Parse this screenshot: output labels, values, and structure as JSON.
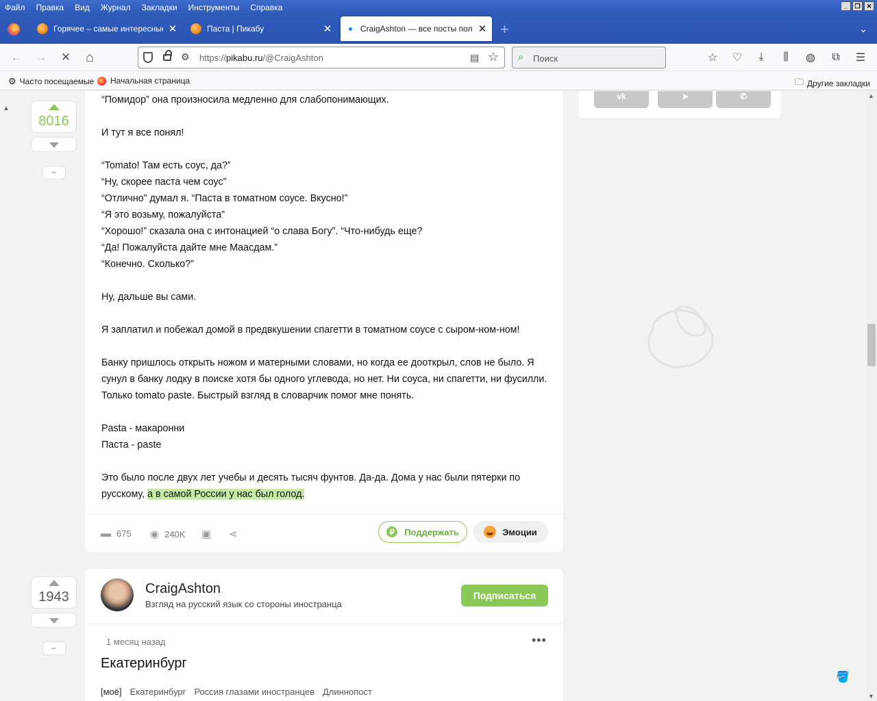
{
  "menu": [
    "Файл",
    "Правка",
    "Вид",
    "Журнал",
    "Закладки",
    "Инструменты",
    "Справка"
  ],
  "window_controls": {
    "minimize": "_",
    "restore": "❐",
    "close": "✕"
  },
  "tabs": [
    {
      "label": "Горячее – самые интересные и о",
      "close": "✕"
    },
    {
      "label": "Паста | Пикабу",
      "close": "✕"
    },
    {
      "label": "CraigAshton — все посты пользов",
      "close": "✕"
    }
  ],
  "new_tab": "+",
  "tab_list": "⌄",
  "nav": {
    "back": "←",
    "forward": "→",
    "stop": "✕",
    "home": "⌂",
    "url_prefix": "https://",
    "url_domain": "pikabu.ru",
    "url_path": "/@CraigAshton",
    "search_placeholder": "Поиск"
  },
  "toolbar_icons": [
    "pocket-save-icon",
    "pocket-icon",
    "download-icon",
    "library-icon",
    "translate-icon",
    "extensions-icon",
    "menu-icon"
  ],
  "bookmarks": {
    "frequent": "Часто посещаемые",
    "start": "Начальная страница",
    "other": "Другие закладки"
  },
  "post1": {
    "rating": "8016",
    "minus": "–",
    "paragraphs": [
      [
        "“Помидор” она произносила медленно для слабопонимающих."
      ],
      [
        "И тут я все понял!"
      ],
      [
        "“Tomato! Там есть соус, да?”",
        "“Ну, скорее паста чем соус”",
        "“Отлично” думал я. “Паста в томатном соусе. Вкусно!”",
        "“Я это возьму, пожалуйста”",
        "“Хорошо!” сказала она с интонацией “о слава Богу”. “Что-нибудь еще?",
        "“Да! Пожалуйста дайте мне Маасдам.”",
        "“Конечно. Сколько?”"
      ],
      [
        "Ну, дальше вы сами."
      ],
      [
        "Я заплатил и побежал домой в предвкушении спагетти в томатном соусе с сыром-ном-ном!"
      ],
      [
        "Банку пришлось открыть ножом и матерными словами, но когда ее доoткрыл, слов не было. Я сунул в банку лодку в поиске хотя бы одного углевода, но нет. Ни соуса, ни спагетти, ни фусилли. Только tomato paste. Быстрый взгляд в словарчик помог мне понять."
      ],
      [
        "Pasta - макаронни",
        "Паста - paste"
      ]
    ],
    "last_text": "Это было после двух лет учебы и десять тысяч фунтов. Да-да. Дома у нас были пятерки по русскому, ",
    "last_highlight": "а в самой России у нас был голод.",
    "comments": "675",
    "views": "240K",
    "support": "Поддержать",
    "emotions": "Эмоции"
  },
  "post2": {
    "rating": "1943",
    "minus": "–",
    "author": "CraigAshton",
    "tagline": "Взгляд на русский язык со стороны иностранца",
    "subscribe": "Подписаться",
    "ago": "1 месяц назад",
    "more": "•••",
    "title": "Екатеринбург",
    "tags": [
      "[моё]",
      "Екатеринбург",
      "Россия глазами иностранцев",
      "Длиннопост"
    ]
  },
  "share": [
    "vk",
    "telegram",
    "viber"
  ],
  "colors": {
    "accent_green": "#8ac858",
    "browser_blue": "#2c58b8",
    "highlight": "#c5eaa2"
  }
}
